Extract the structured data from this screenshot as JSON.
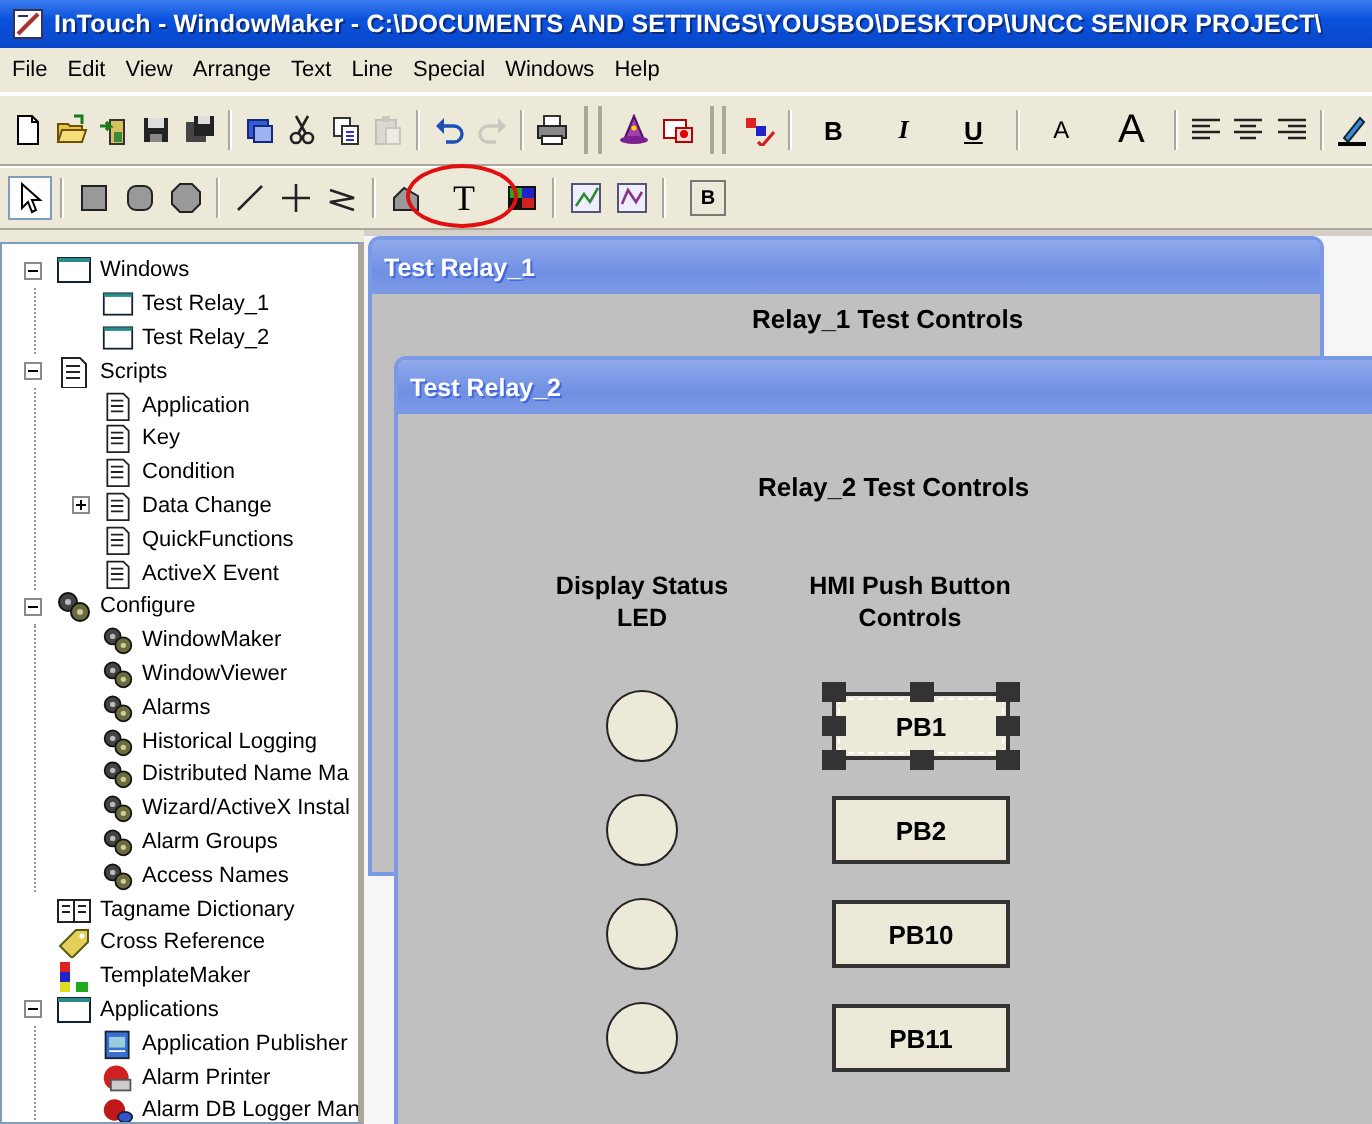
{
  "window": {
    "title": "InTouch - WindowMaker - C:\\DOCUMENTS AND SETTINGS\\YOUSBO\\DESKTOP\\UNCC SENIOR PROJECT\\"
  },
  "menu": [
    "File",
    "Edit",
    "View",
    "Arrange",
    "Text",
    "Line",
    "Special",
    "Windows",
    "Help"
  ],
  "toolbars": [
    {
      "items": [
        {
          "kind": "new",
          "disabled": false
        },
        {
          "kind": "open",
          "disabled": false
        },
        {
          "kind": "import",
          "disabled": false
        },
        {
          "kind": "save",
          "disabled": false
        },
        {
          "kind": "save_all",
          "disabled": false
        },
        {
          "kind": "sep"
        },
        {
          "kind": "window_props",
          "disabled": false
        },
        {
          "kind": "cut",
          "disabled": false
        },
        {
          "kind": "copy",
          "disabled": false
        },
        {
          "kind": "paste",
          "disabled": true
        },
        {
          "kind": "sep"
        },
        {
          "kind": "undo",
          "disabled": false
        },
        {
          "kind": "redo",
          "disabled": true
        },
        {
          "kind": "sep"
        },
        {
          "kind": "print",
          "disabled": false
        },
        {
          "kind": "grip"
        },
        {
          "kind": "wizard",
          "disabled": false
        },
        {
          "kind": "symbol",
          "disabled": false
        },
        {
          "kind": "grip"
        },
        {
          "kind": "spell",
          "disabled": false
        },
        {
          "kind": "sep"
        },
        {
          "kind": "bold",
          "label": "B",
          "disabled": false
        },
        {
          "kind": "italic",
          "label": "I",
          "disabled": false
        },
        {
          "kind": "underline",
          "label": "U",
          "disabled": false
        },
        {
          "kind": "sep"
        },
        {
          "kind": "font_smaller",
          "label": "A",
          "disabled": false
        },
        {
          "kind": "font_larger",
          "label": "A",
          "disabled": false
        },
        {
          "kind": "sep"
        },
        {
          "kind": "align_left",
          "disabled": false
        },
        {
          "kind": "align_center",
          "disabled": false
        },
        {
          "kind": "align_right",
          "disabled": false
        },
        {
          "kind": "sep"
        },
        {
          "kind": "pen",
          "disabled": false
        }
      ]
    },
    {
      "items": [
        {
          "kind": "select",
          "disabled": false
        },
        {
          "kind": "sep"
        },
        {
          "kind": "rect",
          "disabled": false
        },
        {
          "kind": "round_rect",
          "disabled": false
        },
        {
          "kind": "octagon",
          "disabled": false
        },
        {
          "kind": "sep"
        },
        {
          "kind": "line",
          "disabled": false
        },
        {
          "kind": "hv_line",
          "disabled": false
        },
        {
          "kind": "polyline",
          "disabled": false
        },
        {
          "kind": "sep"
        },
        {
          "kind": "polygon",
          "disabled": false
        },
        {
          "kind": "text_tool",
          "label": "T",
          "disabled": false,
          "circled": true
        },
        {
          "kind": "bitmap",
          "disabled": false
        },
        {
          "kind": "sep"
        },
        {
          "kind": "chart",
          "disabled": false
        },
        {
          "kind": "chart2",
          "disabled": false
        },
        {
          "kind": "sep"
        },
        {
          "kind": "button_tool",
          "label": "B",
          "disabled": false
        }
      ]
    }
  ],
  "tree": [
    {
      "label": "Windows",
      "kind": "window",
      "expanded": true,
      "children": [
        {
          "label": "Test Relay_1",
          "kind": "window"
        },
        {
          "label": "Test Relay_2",
          "kind": "window"
        }
      ]
    },
    {
      "label": "Scripts",
      "kind": "script",
      "expanded": true,
      "children": [
        {
          "label": "Application",
          "kind": "script"
        },
        {
          "label": "Key",
          "kind": "script"
        },
        {
          "label": "Condition",
          "kind": "script"
        },
        {
          "label": "Data Change",
          "kind": "script",
          "expanded": false
        },
        {
          "label": "QuickFunctions",
          "kind": "script"
        },
        {
          "label": "ActiveX Event",
          "kind": "script"
        }
      ]
    },
    {
      "label": "Configure",
      "kind": "gear",
      "expanded": true,
      "children": [
        {
          "label": "WindowMaker",
          "kind": "gear"
        },
        {
          "label": "WindowViewer",
          "kind": "gear"
        },
        {
          "label": "Alarms",
          "kind": "gear"
        },
        {
          "label": "Historical Logging",
          "kind": "gear"
        },
        {
          "label": "Distributed Name Ma",
          "kind": "gear"
        },
        {
          "label": "Wizard/ActiveX Instal",
          "kind": "gear"
        },
        {
          "label": "Alarm Groups",
          "kind": "gear"
        },
        {
          "label": "Access Names",
          "kind": "gear"
        }
      ]
    },
    {
      "label": "Tagname Dictionary",
      "kind": "dictionary"
    },
    {
      "label": "Cross Reference",
      "kind": "tag"
    },
    {
      "label": "TemplateMaker",
      "kind": "template"
    },
    {
      "label": "Applications",
      "kind": "window",
      "expanded": true,
      "children": [
        {
          "label": "Application Publisher",
          "kind": "publisher"
        },
        {
          "label": "Alarm Printer",
          "kind": "printer"
        },
        {
          "label": "Alarm DB Logger Man",
          "kind": "logger"
        }
      ]
    }
  ],
  "windows": [
    {
      "title": "Test Relay_1",
      "heading": "Relay_1 Test Controls"
    },
    {
      "title": "Test Relay_2",
      "heading": "Relay_2 Test Controls",
      "columns": [
        "Display Status LED",
        "HMI Push Button Controls"
      ],
      "rows": [
        {
          "led_on": false,
          "button": "PB1",
          "selected": true
        },
        {
          "led_on": false,
          "button": "PB2",
          "selected": false
        },
        {
          "led_on": false,
          "button": "PB10",
          "selected": false
        },
        {
          "led_on": false,
          "button": "PB11",
          "selected": false
        }
      ]
    }
  ]
}
